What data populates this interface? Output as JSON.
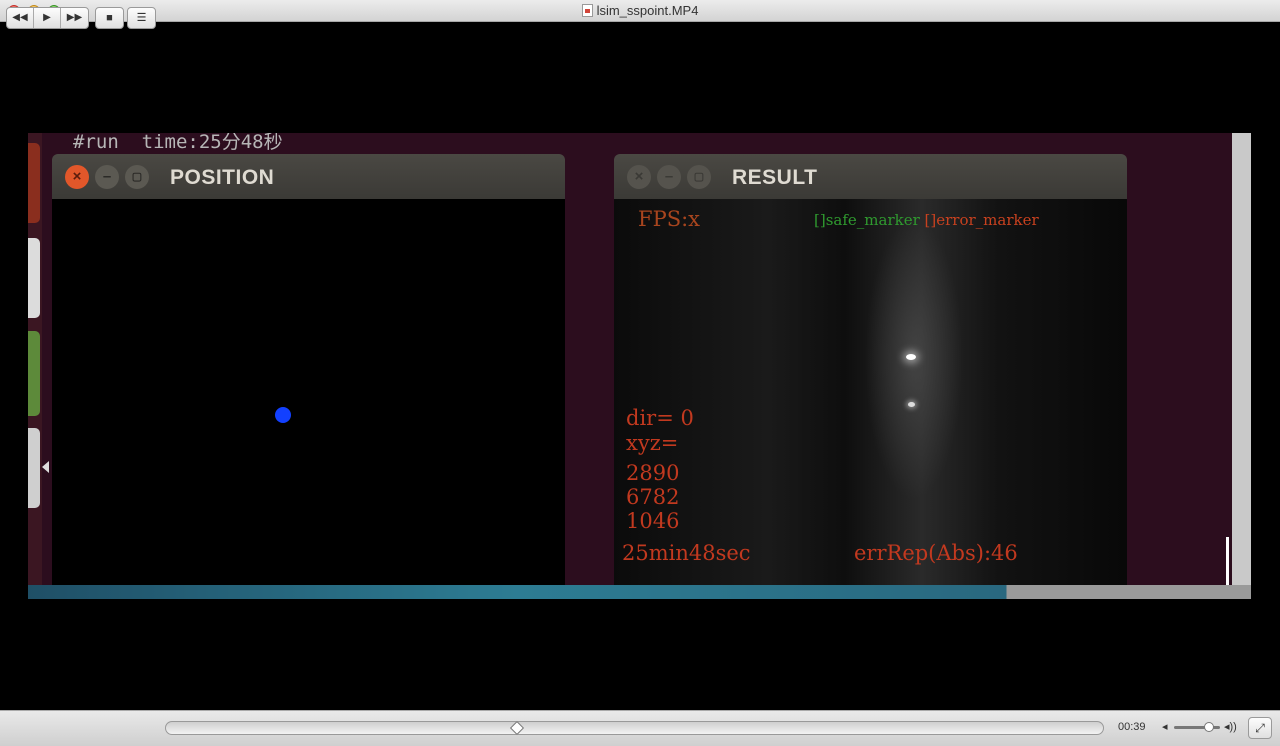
{
  "window": {
    "title": "lsim_sspoint.MP4"
  },
  "video": {
    "terminal_text": "#run  time:25分48秒",
    "position_window": {
      "title": "POSITION"
    },
    "result_window": {
      "title": "RESULT",
      "fps": "FPS:x",
      "legend_safe": "[]safe_marker",
      "legend_error": "[]error_marker",
      "dir": "dir= 0",
      "xyz_label": "xyz=",
      "x": "2890",
      "y": "6782",
      "z": "1046",
      "elapsed": "25min48sec",
      "err": "errRep(Abs):46"
    }
  },
  "controls": {
    "rewind": "◀◀",
    "play": "▶",
    "fast_forward": "▶▶",
    "stop": "■",
    "playlist": "☰",
    "timecode": "00:39",
    "progress": 0.375,
    "volume": 0.75,
    "vol_low_icon": "◂",
    "vol_high_icon": "◂))",
    "fullscreen": "⤢"
  }
}
